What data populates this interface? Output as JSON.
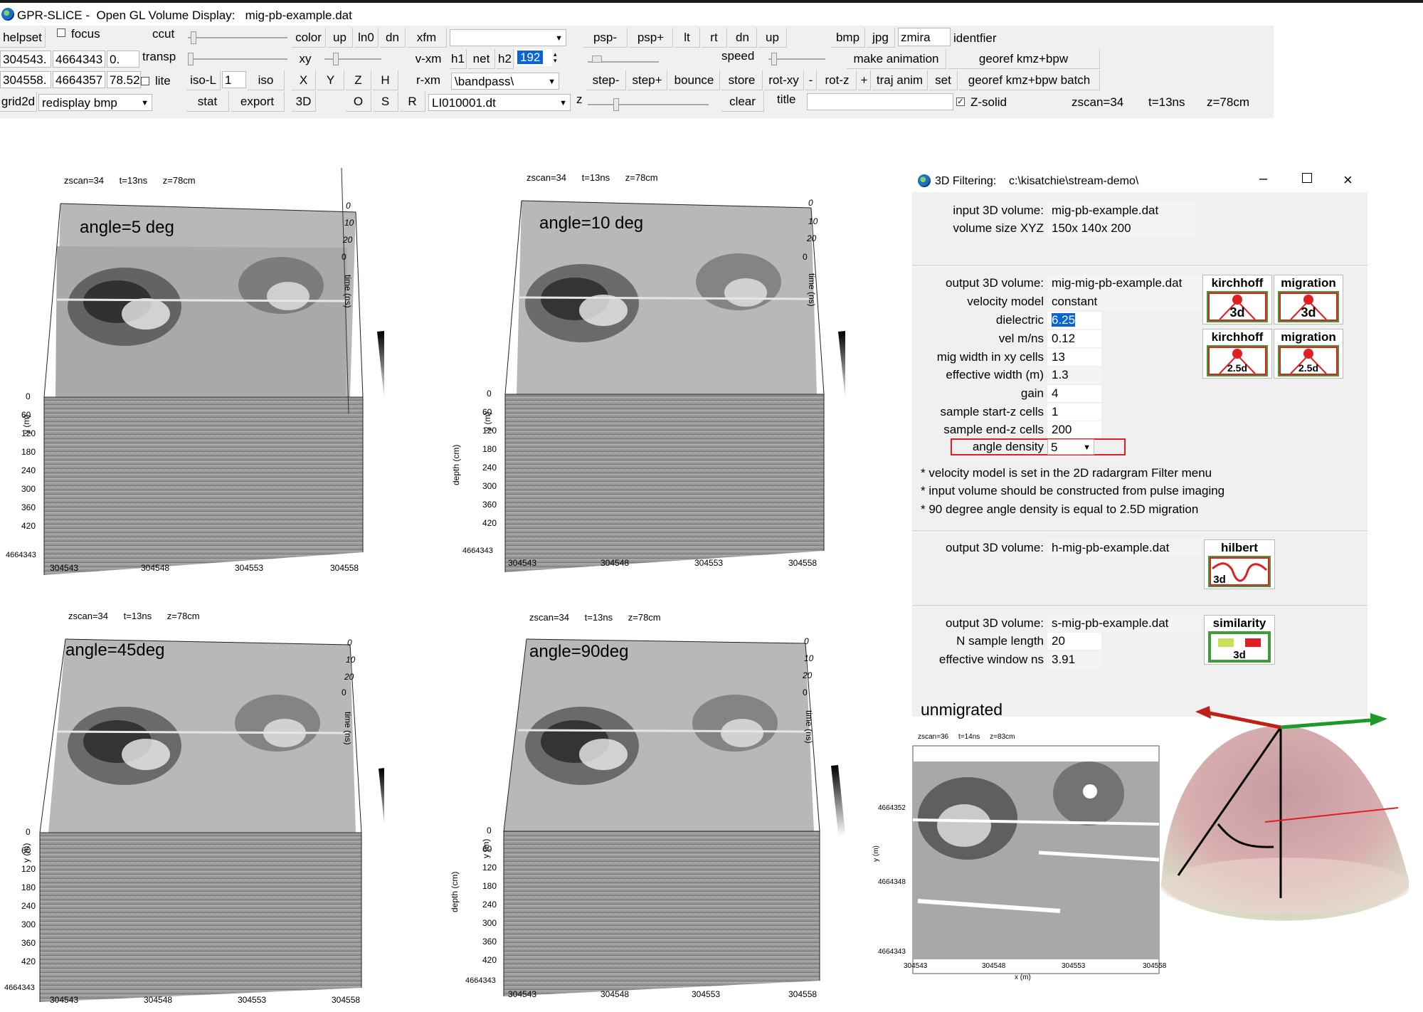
{
  "window": {
    "title": "GPR-SLICE -  Open GL Volume Display:   mig-pb-example.dat"
  },
  "toolbar": {
    "helpset": "helpset",
    "focus": "focus",
    "ccut": "ccut",
    "color": "color",
    "up1": "up",
    "ln0": "ln0",
    "dn1": "dn",
    "xfm": "xfm",
    "psp_minus": "psp-",
    "psp_plus": "psp+",
    "lt": "lt",
    "rt": "rt",
    "dn2": "dn",
    "up2": "up",
    "bmp": "bmp",
    "jpg": "jpg",
    "zmira": "zmira",
    "identifier": "identfier",
    "coord1_a": "304543.",
    "coord1_b": "4664343",
    "coord1_c": "0.",
    "transp": "transp",
    "xy": "xy",
    "v_xm": "v-xm",
    "h1": "h1",
    "net": "net",
    "h2": "h2",
    "h2_value": "192",
    "speed": "speed",
    "make_animation": "make animation",
    "georef": "georef kmz+bpw",
    "coord2_a": "304558.",
    "coord2_b": "4664357",
    "coord2_c": "78.52",
    "lite": "lite",
    "iso_l": "iso-L",
    "iso_l_value": "1",
    "iso": "iso",
    "x": "X",
    "y": "Y",
    "z": "Z",
    "h": "H",
    "r_xm": "r-xm",
    "bandpass": "\\bandpass\\",
    "step_minus": "step-",
    "step_plus": "step+",
    "bounce": "bounce",
    "store": "store",
    "rot_xy": "rot-xy",
    "minus": "-",
    "rot_z": "rot-z",
    "plus": "+",
    "traj_anim": "traj anim",
    "set": "set",
    "georef_batch": "georef kmz+bpw batch",
    "grid2d": "grid2d",
    "redisplay": "redisplay bmp",
    "stat": "stat",
    "export": "export",
    "btn3d": "3D",
    "o": "O",
    "s": "S",
    "r": "R",
    "file": "LI010001.dt",
    "z_label": "z",
    "clear": "clear",
    "title": "title",
    "z_solid": "Z-solid",
    "zscan": "zscan=34",
    "t": "t=13ns",
    "zdepth": "z=78cm"
  },
  "views": [
    {
      "header": "zscan=34      t=13ns      z=78cm",
      "label": "angle=5 deg"
    },
    {
      "header": "zscan=34      t=13ns      z=78cm",
      "label": "angle=10 deg"
    },
    {
      "header": "zscan=34      t=13ns      z=78cm",
      "label": "angle=45deg"
    },
    {
      "header": "zscan=34      t=13ns      z=78cm",
      "label": "angle=90deg"
    }
  ],
  "cube_axes": {
    "x_ticks": [
      "304543",
      "304548",
      "304553",
      "304558"
    ],
    "depth_ticks": [
      "0",
      "60",
      "120",
      "180",
      "240",
      "300",
      "360",
      "420"
    ],
    "y_tick": "4664343",
    "time_ticks": [
      "0",
      "10",
      "20"
    ],
    "depth_label": "depth (cm)",
    "y_label": "y (m)",
    "time_label": "time (ns)",
    "side_tick": "0"
  },
  "filter_dialog": {
    "title": "3D Filtering:    c:\\kisatchie\\stream-demo\\",
    "input_label": "input 3D volume:",
    "input_value": "mig-pb-example.dat",
    "size_label": "volume size XYZ",
    "size_value": "150x 140x 200",
    "output_label": "output 3D volume:",
    "output_value": "mig-mig-pb-example.dat",
    "vmodel_label": "velocity model",
    "vmodel_value": "constant",
    "dielectric_label": "dielectric",
    "dielectric_value": "6.25",
    "vel_label": "vel m/ns",
    "vel_value": "0.12",
    "migwidth_label": "mig width in xy cells",
    "migwidth_value": "13",
    "effwidth_label": "effective width (m)",
    "effwidth_value": "1.3",
    "gain_label": "gain",
    "gain_value": "4",
    "start_label": "sample start-z cells",
    "start_value": "1",
    "end_label": "sample end-z cells",
    "end_value": "200",
    "angle_label": "angle density",
    "angle_value": "5",
    "note1": "* velocity model is set in the 2D radargram Filter menu",
    "note2": "* input volume should be constructed from pulse imaging",
    "note3": "* 90 degree angle density is equal to 2.5D migration",
    "kirchhoff": "kirchhoff",
    "migration": "migration",
    "tag3d": "3d",
    "tag25d": "2.5d",
    "h_output_label": "output 3D volume:",
    "h_output_value": "h-mig-pb-example.dat",
    "hilbert": "hilbert",
    "s_output_label": "output 3D volume:",
    "s_output_value": "s-mig-pb-example.dat",
    "similarity": "similarity",
    "nsample_label": "N sample length",
    "nsample_value": "20",
    "effwin_label": "effective window ns",
    "effwin_value": "3.91"
  },
  "unmigrated": {
    "label": "unmigrated",
    "header": "zscan=36     t=14ns     z=83cm",
    "y_ticks": [
      "4664352",
      "4664348",
      "4664343"
    ],
    "x_ticks": [
      "304543",
      "304548",
      "304553",
      "304558"
    ],
    "x_label": "x (m)",
    "y_label": "y (m)"
  },
  "colors": {
    "highlight": "#0a64d6",
    "red_box": "#e02020",
    "green": "#3f9a3a"
  }
}
